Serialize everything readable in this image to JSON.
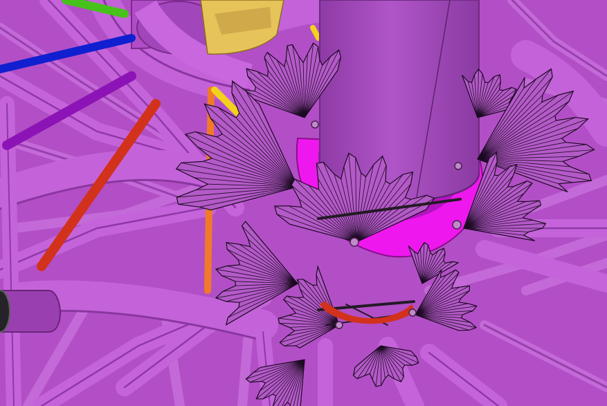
{
  "scene": {
    "kind": "3d-render",
    "palette": {
      "background": "#b24fc6",
      "tube": "#c060d6",
      "tube_dark": "#9a3fb0",
      "tube_edge": "#7a2a8c",
      "magenta_core": "#ee18ee",
      "yellow_block": "#e6c45a",
      "blue_rod": "#1020d0",
      "green_rod": "#46c21a",
      "purple_rod": "#8c14b6",
      "red_rod": "#d2311c",
      "orange_rod": "#f07a2a",
      "yellow_rod": "#f2d21c",
      "fan_fill": "#b45ac8",
      "fan_line": "#1c0a22",
      "wire": "#241a26",
      "cylinder": "#a24cba"
    }
  }
}
